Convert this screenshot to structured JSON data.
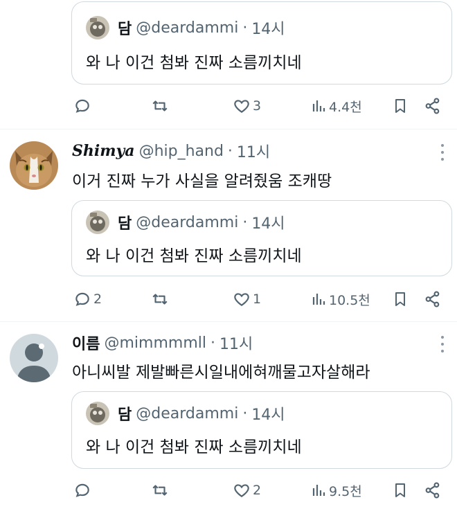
{
  "quoted": {
    "name": "담",
    "handle": "@deardammi",
    "dot": "·",
    "time": "14시",
    "text": "와 나 이건 첨봐 진짜 소름끼치네"
  },
  "posts": [
    {
      "actions": {
        "reply": "",
        "repost": "",
        "like": "3",
        "views": "4.4천"
      }
    },
    {
      "name": "Shimya",
      "handle": "@hip_hand",
      "dot": "·",
      "time": "11시",
      "text": "이거 진짜 누가 사실을 알려줬움 조캐땅",
      "actions": {
        "reply": "2",
        "repost": "",
        "like": "1",
        "views": "10.5천"
      }
    },
    {
      "name": "이름",
      "handle": "@mimmmmll",
      "dot": "·",
      "time": "11시",
      "text": "아니씨발 제발빠른시일내에혀깨물고자살해라",
      "actions": {
        "reply": "",
        "repost": "",
        "like": "2",
        "views": "9.5천"
      }
    }
  ],
  "colors": {
    "text": "#0f1419",
    "secondary": "#536471",
    "border": "#cfd9de",
    "divider": "#eff3f4"
  },
  "icons": [
    "reply-icon",
    "repost-icon",
    "like-icon",
    "views-icon",
    "bookmark-icon",
    "share-icon",
    "more-icon"
  ]
}
